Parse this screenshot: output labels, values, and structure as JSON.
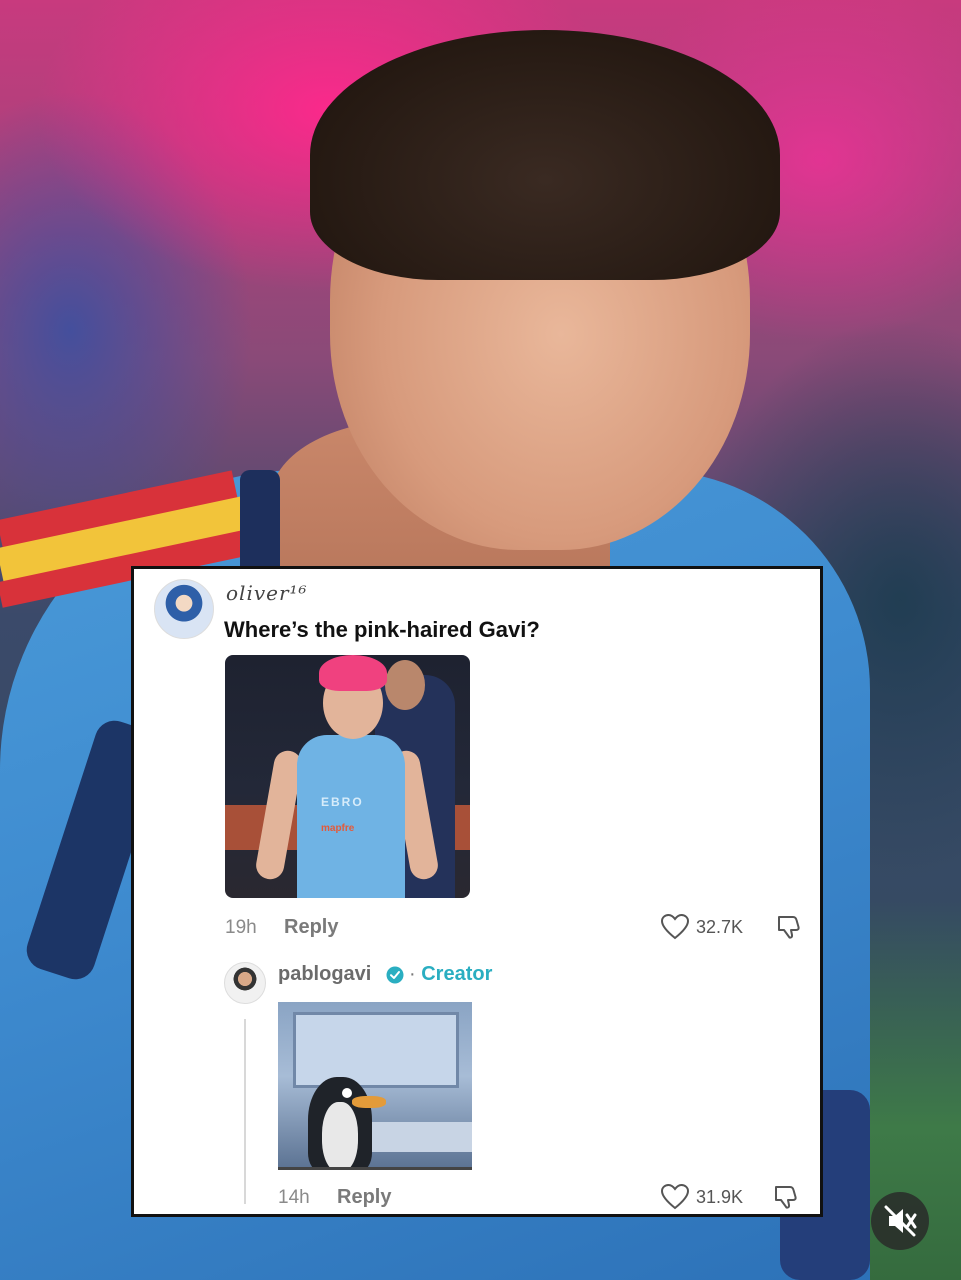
{
  "comment": {
    "username": "oliver¹⁶",
    "text": "Where’s the pink-haired Gavi?",
    "time": "19h",
    "reply_label": "Reply",
    "likes": "32.7K",
    "image": {
      "text_sponsor": "EBRO",
      "text_sponsor2": "mapfre"
    }
  },
  "reply": {
    "username": "pablogavi",
    "badge_separator": "·",
    "badge": "Creator",
    "time": "14h",
    "reply_label": "Reply",
    "likes": "31.9K"
  },
  "icons": {
    "like": "heart-icon",
    "dislike": "thumbs-down-icon",
    "verified": "verified-check-icon",
    "mute": "speaker-muted-icon"
  },
  "colors": {
    "creator": "#2aaec1",
    "verified": "#2aaec1",
    "card_border": "#111111"
  }
}
